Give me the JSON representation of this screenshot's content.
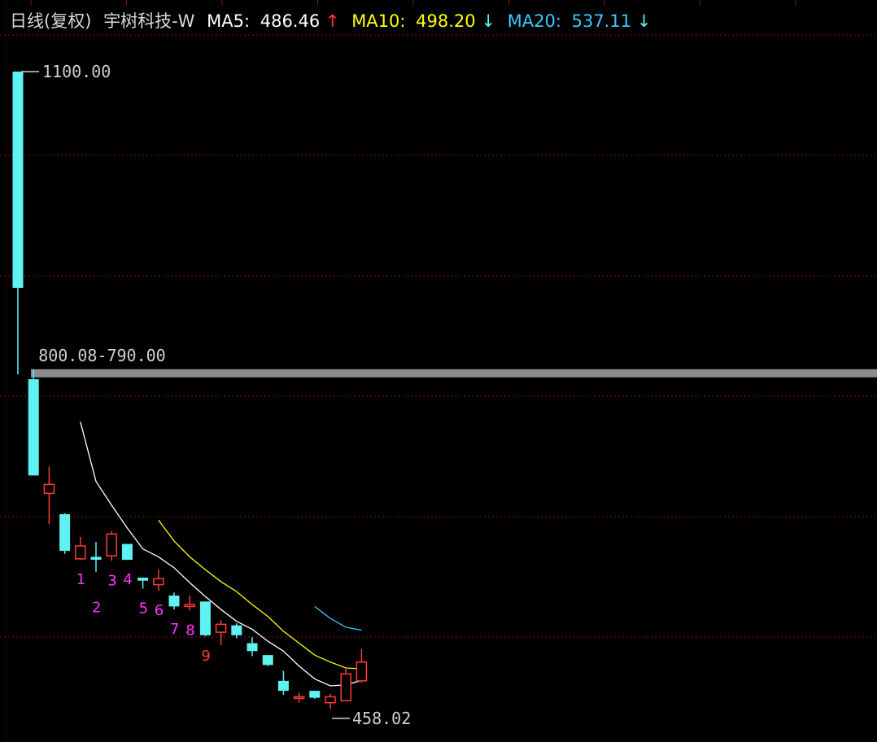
{
  "header": {
    "period": "日线(复权)",
    "stock": "宇树科技-W",
    "ma5_label": "MA5:",
    "ma5_value": "486.46",
    "ma5_arrow": "↑",
    "ma10_label": "MA10:",
    "ma10_value": "498.20",
    "ma10_arrow": "↓",
    "ma20_label": "MA20:",
    "ma20_value": "537.11",
    "ma20_arrow": "↓"
  },
  "colors": {
    "up": "#ff3b30",
    "down": "#5ef2f2",
    "ma5": "#ffffff",
    "ma10": "#ffff00",
    "ma20": "#3cc8ff",
    "grid": "#8a1212",
    "seq_a": "#ff33ff",
    "seq_b": "#ff3b30",
    "level_bar": "#8c8c8c"
  },
  "chart_data": {
    "type": "candlestick",
    "annotations": {
      "high_label": "1100.00",
      "high_value": 1100.0,
      "gap_label": "800.08-790.00",
      "gap_top": 800.08,
      "gap_bottom": 790.0,
      "low_label": "458.02",
      "low_value": 458.02
    },
    "candles": [
      {
        "open": 1100.0,
        "high": 1100.0,
        "low": 795.0,
        "close": 882.0
      },
      {
        "open": 790.0,
        "high": 800.08,
        "low": 790.0,
        "close": 693.0
      },
      {
        "open": 675.0,
        "high": 702.0,
        "low": 644.0,
        "close": 684.0
      },
      {
        "open": 654.0,
        "high": 655.0,
        "low": 614.0,
        "close": 617.0
      },
      {
        "open": 609.0,
        "high": 631.0,
        "low": 608.0,
        "close": 622.0
      },
      {
        "open": 611.0,
        "high": 626.0,
        "low": 596.0,
        "close": 608.0
      },
      {
        "open": 612.0,
        "high": 637.0,
        "low": 607.0,
        "close": 634.0
      },
      {
        "open": 624.0,
        "high": 624.0,
        "low": 608.0,
        "close": 608.0
      },
      {
        "open": 590.0,
        "high": 590.0,
        "low": 579.0,
        "close": 587.0
      },
      {
        "open": 583.0,
        "high": 598.0,
        "low": 577.0,
        "close": 589.0
      },
      {
        "open": 572.0,
        "high": 575.0,
        "low": 558.0,
        "close": 561.0
      },
      {
        "open": 561.0,
        "high": 572.0,
        "low": 557.0,
        "close": 563.0
      },
      {
        "open": 566.0,
        "high": 566.0,
        "low": 531.0,
        "close": 532.0
      },
      {
        "open": 535.0,
        "high": 547.0,
        "low": 522.0,
        "close": 543.0
      },
      {
        "open": 542.0,
        "high": 544.0,
        "low": 529.0,
        "close": 532.0
      },
      {
        "open": 524.0,
        "high": 530.0,
        "low": 511.0,
        "close": 516.0
      },
      {
        "open": 512.0,
        "high": 512.0,
        "low": 501.0,
        "close": 502.0
      },
      {
        "open": 486.0,
        "high": 496.0,
        "low": 472.0,
        "close": 476.0
      },
      {
        "open": 470.0,
        "high": 474.0,
        "low": 464.0,
        "close": 470.0
      },
      {
        "open": 476.0,
        "high": 476.0,
        "low": 468.0,
        "close": 469.0
      },
      {
        "open": 464.0,
        "high": 473.0,
        "low": 458.02,
        "close": 470.0
      },
      {
        "open": 466.0,
        "high": 500.0,
        "low": 466.0,
        "close": 493.0
      },
      {
        "open": 486.0,
        "high": 518.0,
        "low": 484.0,
        "close": 505.0
      }
    ],
    "sequence_labels": [
      {
        "candle": 4,
        "text": "1",
        "tier": 0,
        "color": "seq_a"
      },
      {
        "candle": 5,
        "text": "2",
        "tier": 1,
        "color": "seq_a"
      },
      {
        "candle": 6,
        "text": "3",
        "tier": 0,
        "color": "seq_a"
      },
      {
        "candle": 7,
        "text": "4",
        "tier": 0,
        "color": "seq_a"
      },
      {
        "candle": 8,
        "text": "5",
        "tier": 0,
        "color": "seq_a"
      },
      {
        "candle": 9,
        "text": "6",
        "tier": 0,
        "color": "seq_a"
      },
      {
        "candle": 10,
        "text": "7",
        "tier": 0,
        "color": "seq_a"
      },
      {
        "candle": 11,
        "text": "8",
        "tier": 0,
        "color": "seq_a"
      },
      {
        "candle": 12,
        "text": "9",
        "tier": 0,
        "color": "seq_b"
      }
    ],
    "ma5": [
      null,
      null,
      null,
      null,
      747,
      687,
      663,
      640,
      619,
      611,
      600,
      585,
      571,
      558,
      546,
      538,
      526,
      516,
      501,
      488,
      481,
      482,
      486.46
    ],
    "ma10": [
      null,
      null,
      null,
      null,
      null,
      null,
      null,
      null,
      null,
      648,
      627,
      611,
      598,
      586,
      576,
      563,
      551,
      536,
      524,
      512,
      505,
      499,
      498.2
    ],
    "ma20": [
      null,
      null,
      null,
      null,
      null,
      null,
      null,
      null,
      null,
      null,
      null,
      null,
      null,
      null,
      null,
      null,
      null,
      null,
      null,
      561,
      549,
      540,
      537.11
    ]
  }
}
